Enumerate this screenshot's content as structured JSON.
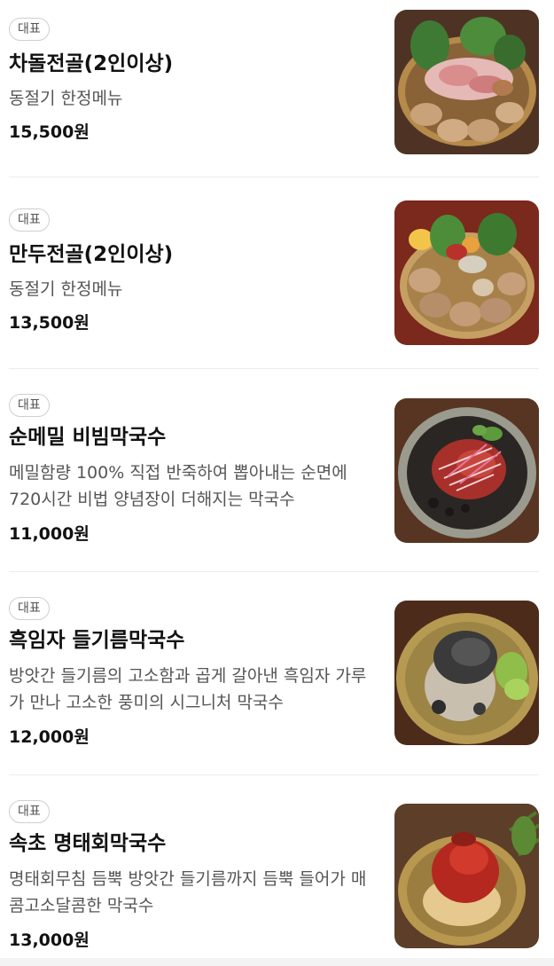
{
  "menu": {
    "items": [
      {
        "badge": "대표",
        "name": "차돌전골(2인이상)",
        "desc": "동절기 한정메뉴",
        "price": "15,500원",
        "photo": "beef-brisket-hotpot"
      },
      {
        "badge": "대표",
        "name": "만두전골(2인이상)",
        "desc": "동절기 한정메뉴",
        "price": "13,500원",
        "photo": "dumpling-hotpot"
      },
      {
        "badge": "대표",
        "name": "순메밀 비빔막국수",
        "desc": "메밀함량 100% 직접 반죽하여 뽑아내는 순면에 720시간 비법 양념장이 더해지는 막국수",
        "price": "11,000원",
        "photo": "spicy-buckwheat-noodles"
      },
      {
        "badge": "대표",
        "name": "흑임자 들기름막국수",
        "desc": "방앗간 들기름의 고소함과 곱게 갈아낸 흑임자 가루가 만나 고소한 풍미의 시그니처 막국수",
        "price": "12,000원",
        "photo": "black-sesame-perilla-oil-noodles"
      },
      {
        "badge": "대표",
        "name": "속초 명태회막국수",
        "desc": "명태회무침 듬뿍 방앗간 들기름까지 듬뿍 들어가 매콤고소달콤한 막국수",
        "price": "13,000원",
        "photo": "pollock-sashimi-noodles"
      }
    ]
  }
}
